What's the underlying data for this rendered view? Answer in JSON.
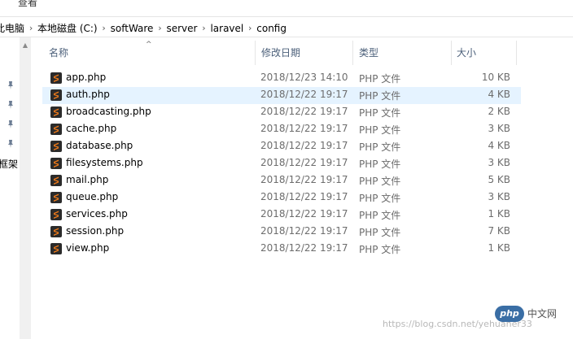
{
  "ribbon": {
    "view_tab": "查看"
  },
  "breadcrumb": [
    "此电脑",
    "本地磁盘 (C:)",
    "softWare",
    "server",
    "laravel",
    "config"
  ],
  "nav": {
    "partial_label": "框架"
  },
  "columns": {
    "name": "名称",
    "modified": "修改日期",
    "type": "类型",
    "size": "大小"
  },
  "files": [
    {
      "name": "app.php",
      "modified": "2018/12/23 14:10",
      "type": "PHP 文件",
      "size": "10 KB",
      "selected": false
    },
    {
      "name": "auth.php",
      "modified": "2018/12/22 19:17",
      "type": "PHP 文件",
      "size": "4 KB",
      "selected": true
    },
    {
      "name": "broadcasting.php",
      "modified": "2018/12/22 19:17",
      "type": "PHP 文件",
      "size": "2 KB",
      "selected": false
    },
    {
      "name": "cache.php",
      "modified": "2018/12/22 19:17",
      "type": "PHP 文件",
      "size": "3 KB",
      "selected": false
    },
    {
      "name": "database.php",
      "modified": "2018/12/22 19:17",
      "type": "PHP 文件",
      "size": "4 KB",
      "selected": false
    },
    {
      "name": "filesystems.php",
      "modified": "2018/12/22 19:17",
      "type": "PHP 文件",
      "size": "3 KB",
      "selected": false
    },
    {
      "name": "mail.php",
      "modified": "2018/12/22 19:17",
      "type": "PHP 文件",
      "size": "5 KB",
      "selected": false
    },
    {
      "name": "queue.php",
      "modified": "2018/12/22 19:17",
      "type": "PHP 文件",
      "size": "3 KB",
      "selected": false
    },
    {
      "name": "services.php",
      "modified": "2018/12/22 19:17",
      "type": "PHP 文件",
      "size": "1 KB",
      "selected": false
    },
    {
      "name": "session.php",
      "modified": "2018/12/22 19:17",
      "type": "PHP 文件",
      "size": "7 KB",
      "selected": false
    },
    {
      "name": "view.php",
      "modified": "2018/12/22 19:17",
      "type": "PHP 文件",
      "size": "1 KB",
      "selected": false
    }
  ],
  "watermark": {
    "logo": "php",
    "cn": "中文网",
    "url": "https://blog.csdn.net/yehuaner33"
  },
  "colors": {
    "selected_row": "#e5f3ff",
    "header_text": "#4c607a",
    "file_icon": "#f07b1a",
    "secondary_text": "#6d6d6d"
  },
  "icons": {
    "file": "sublime-php-file-icon",
    "pin": "pin-icon"
  }
}
